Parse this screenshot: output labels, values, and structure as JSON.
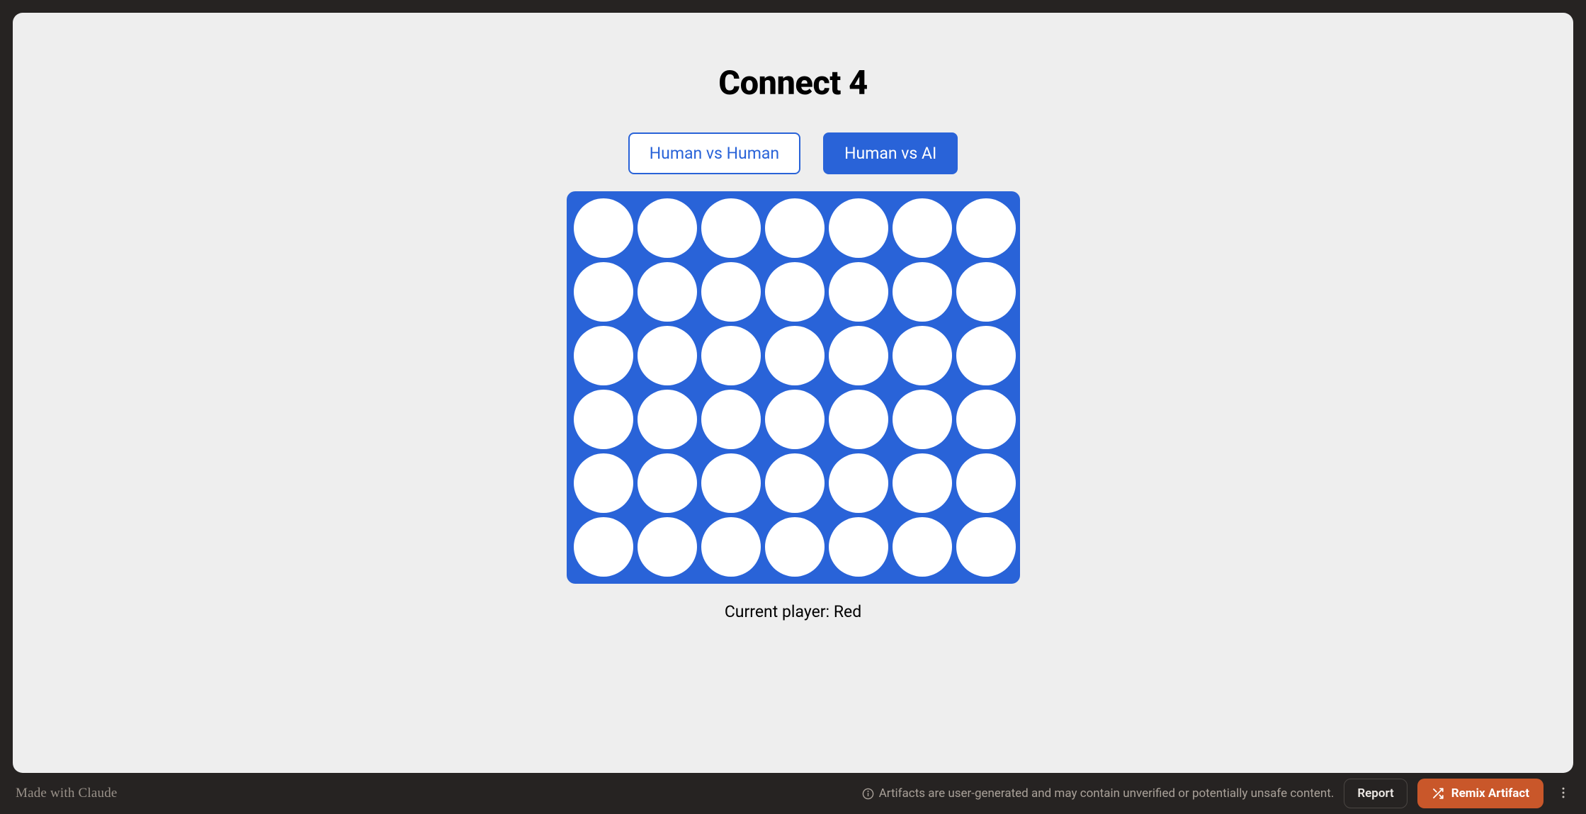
{
  "game": {
    "title": "Connect 4",
    "modes": {
      "human_vs_human": "Human vs Human",
      "human_vs_ai": "Human vs AI",
      "selected": "human_vs_ai"
    },
    "board": {
      "rows": 6,
      "cols": 7,
      "cells": [
        [
          "empty",
          "empty",
          "empty",
          "empty",
          "empty",
          "empty",
          "empty"
        ],
        [
          "empty",
          "empty",
          "empty",
          "empty",
          "empty",
          "empty",
          "empty"
        ],
        [
          "empty",
          "empty",
          "empty",
          "empty",
          "empty",
          "empty",
          "empty"
        ],
        [
          "empty",
          "empty",
          "empty",
          "empty",
          "empty",
          "empty",
          "empty"
        ],
        [
          "empty",
          "empty",
          "empty",
          "empty",
          "empty",
          "empty",
          "empty"
        ],
        [
          "empty",
          "empty",
          "empty",
          "empty",
          "empty",
          "empty",
          "empty"
        ]
      ]
    },
    "status_text": "Current player: Red",
    "current_player": "Red"
  },
  "footer": {
    "made_with": "Made with Claude",
    "disclaimer": "Artifacts are user-generated and may contain unverified or potentially unsafe content.",
    "report_label": "Report",
    "remix_label": "Remix Artifact"
  },
  "colors": {
    "board_blue": "#2963d8",
    "frame_bg": "#eeeeee",
    "outer_bg": "#262322",
    "remix_orange": "#c9572a"
  }
}
